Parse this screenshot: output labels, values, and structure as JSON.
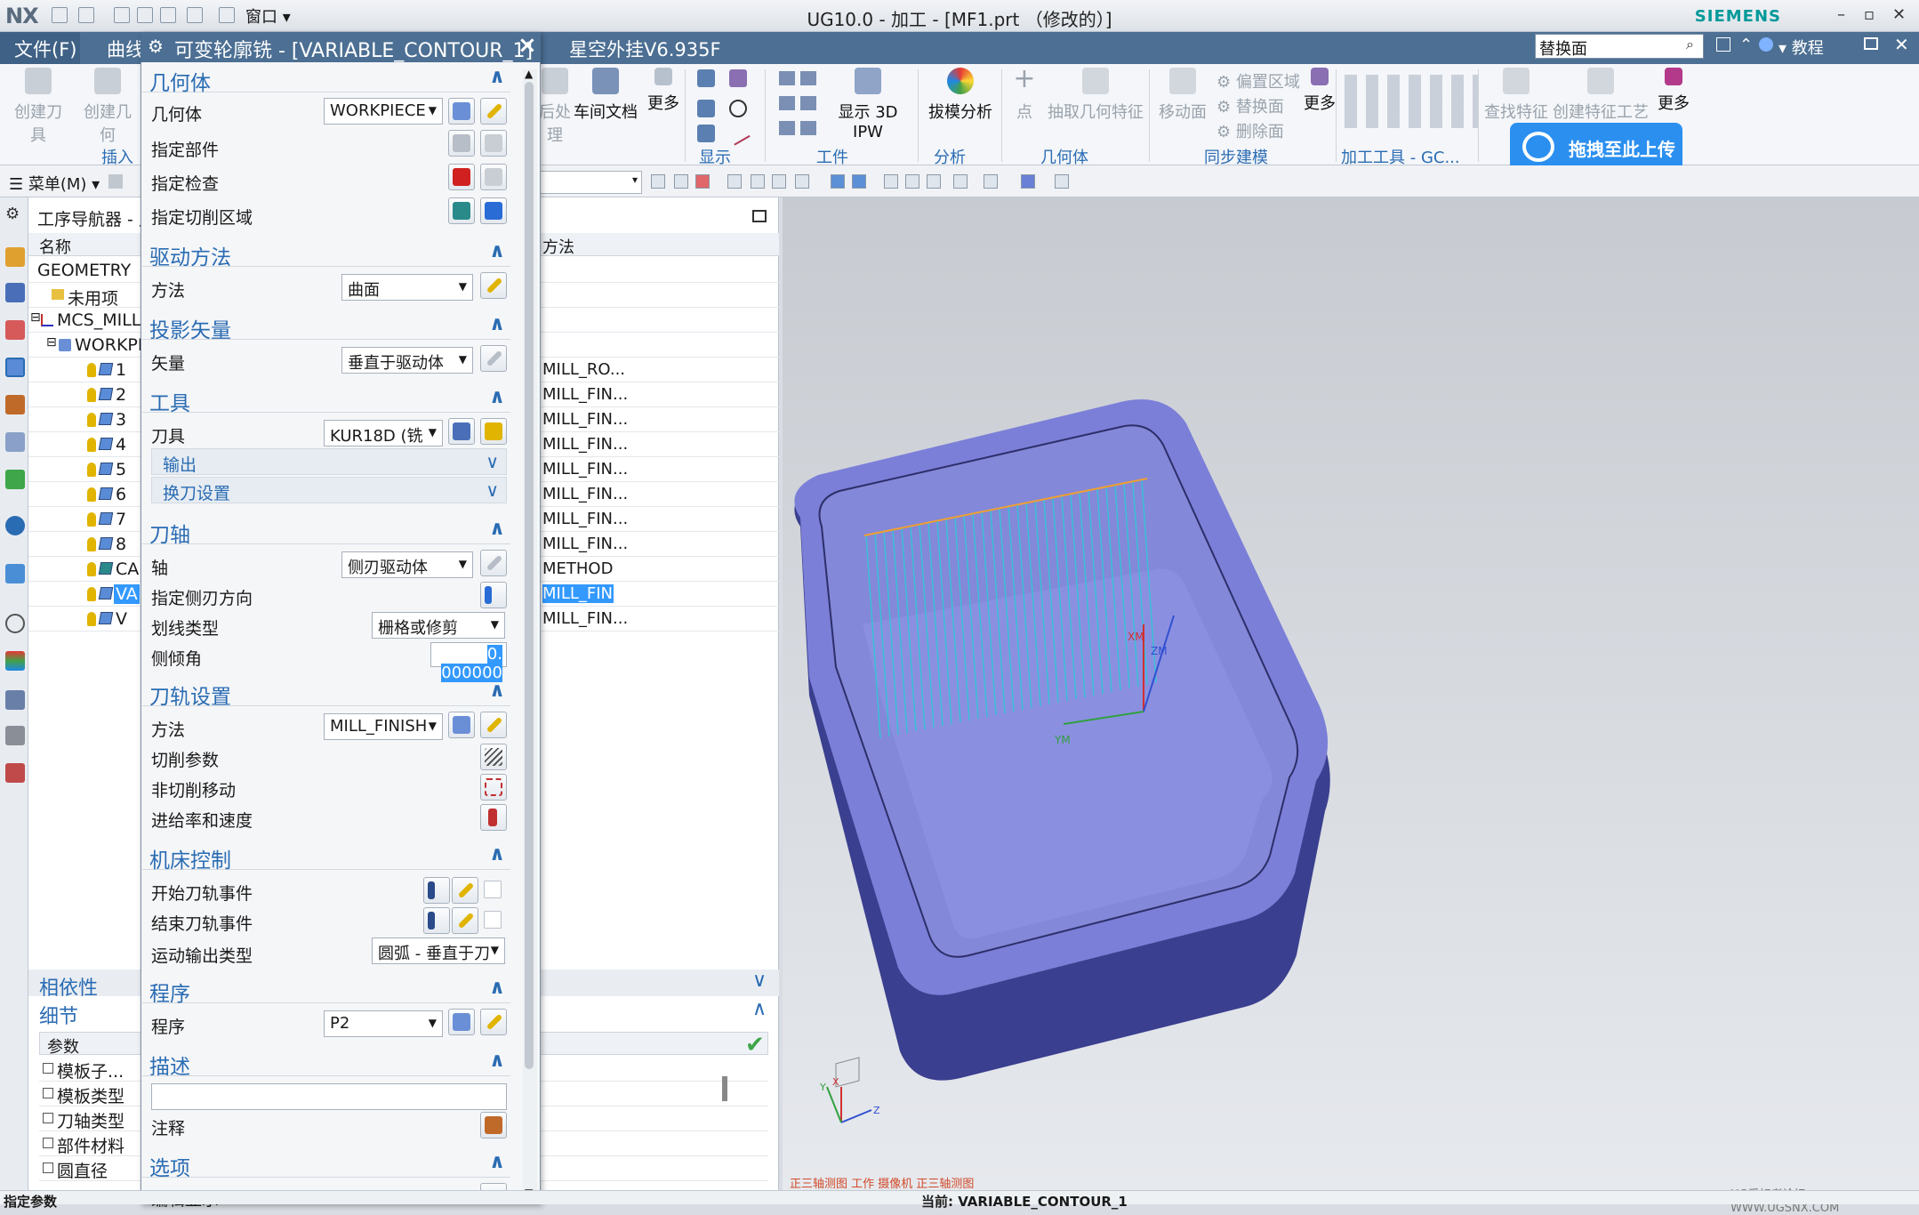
{
  "titlebar": {
    "logo": "NX",
    "title": "UG10.0 - 加工 - [MF1.prt （修改的）]",
    "brand": "SIEMENS",
    "window_menu": "窗口",
    "min": "–",
    "restore": "▫",
    "close": "✕"
  },
  "tabs": {
    "file": "文件(F)",
    "curve": "曲线",
    "plugin": "星空外挂V6.935F",
    "search_value": "替换面",
    "tutorial": "教程"
  },
  "ribbon": {
    "create_tool": "创建刀具",
    "create_geometry": "创建几何",
    "insert_group": "插入",
    "post_process": "后处理",
    "shop_doc": "车间文档",
    "more1": "更多",
    "display_group": "显示",
    "show_3d_ipw": "显示 3D IPW",
    "workpiece_group": "工件",
    "draft_analysis": "拔模分析",
    "analysis_group": "分析",
    "point": "点",
    "extract_geometry": "抽取几何特征",
    "geometry_group": "几何体",
    "move_face": "移动面",
    "offset_region": "偏置区域",
    "replace_face": "替换面",
    "delete_face": "删除面",
    "more2": "更多",
    "sync_group": "同步建模",
    "find_feature": "查找特征",
    "create_feature_process": "创建特征工艺",
    "more3": "更多",
    "machining_tools_group": "加工工具 - GC...",
    "upload": "拖拽至此上传"
  },
  "toolbar2": {
    "menu": "菜单(M)"
  },
  "navigator": {
    "title": "工序导航器 - 几何",
    "col_name": "名称",
    "col_method": "方法",
    "rows": [
      {
        "name": "GEOMETRY",
        "method": ""
      },
      {
        "name": "未用项",
        "method": ""
      },
      {
        "name": "MCS_MILL",
        "method": ""
      },
      {
        "name": "WORKPIECE",
        "method": ""
      },
      {
        "name": "1",
        "method": "MILL_RO..."
      },
      {
        "name": "2",
        "method": "MILL_FIN..."
      },
      {
        "name": "3",
        "method": "MILL_FIN..."
      },
      {
        "name": "4",
        "method": "MILL_FIN..."
      },
      {
        "name": "5",
        "method": "MILL_FIN..."
      },
      {
        "name": "6",
        "method": "MILL_FIN..."
      },
      {
        "name": "7",
        "method": "MILL_FIN..."
      },
      {
        "name": "8",
        "method": "MILL_FIN..."
      },
      {
        "name": "CA",
        "method": "METHOD"
      },
      {
        "name": "VA",
        "method": "MILL_FIN..."
      },
      {
        "name": "V",
        "method": "MILL_FIN..."
      }
    ],
    "dependency": "相依性",
    "details": "细节",
    "detail_col": "参数",
    "detail_rows": [
      "模板子...",
      "模板类型",
      "刀轴类型",
      "部件材料",
      "圆直径"
    ]
  },
  "dialog": {
    "title": "可变轮廓铣 - [VARIABLE_CONTOUR_1]",
    "geometry": {
      "header": "几何体",
      "label_geometry": "几何体",
      "geometry_value": "WORKPIECE",
      "specify_part": "指定部件",
      "specify_check": "指定检查",
      "specify_cut_area": "指定切削区域"
    },
    "drive": {
      "header": "驱动方法",
      "label_method": "方法",
      "method_value": "曲面"
    },
    "projection": {
      "header": "投影矢量",
      "label_vector": "矢量",
      "vector_value": "垂直于驱动体"
    },
    "tool": {
      "header": "工具",
      "label_tool": "刀具",
      "tool_value": "KUR18D (铣",
      "output": "输出",
      "tool_change": "换刀设置"
    },
    "axis": {
      "header": "刀轴",
      "label_axis": "轴",
      "axis_value": "侧刃驱动体",
      "side_direction": "指定侧刃方向",
      "stroke_type": "划线类型",
      "stroke_value": "栅格或修剪",
      "tilt_angle": "侧倾角",
      "tilt_value": "0. 000000"
    },
    "toolpath": {
      "header": "刀轨设置",
      "label_method": "方法",
      "method_value": "MILL_FINISH",
      "cut_params": "切削参数",
      "non_cut_moves": "非切削移动",
      "feeds_speeds": "进给率和速度"
    },
    "machine": {
      "header": "机床控制",
      "start_event": "开始刀轨事件",
      "end_event": "结束刀轨事件",
      "motion_output": "运动输出类型",
      "motion_value": "圆弧 - 垂直于刀"
    },
    "program": {
      "header": "程序",
      "label_program": "程序",
      "program_value": "P2"
    },
    "description": {
      "header": "描述",
      "notes": "注释"
    },
    "options": {
      "header": "选项",
      "edit_display": "编辑显示"
    }
  },
  "graphics": {
    "view_label": "正三轴测图 工作 摄像机 正三轴测图",
    "watermark": "UG爱好者论坛 · WWW.UGSNX.COM",
    "axis_xm": "XM",
    "axis_ym": "YM",
    "axis_zm": "ZM",
    "triad_x": "X",
    "triad_y": "Y",
    "triad_z": "Z"
  },
  "status": {
    "left": "指定参数",
    "mid": "当前: VARIABLE_CONTOUR_1"
  }
}
